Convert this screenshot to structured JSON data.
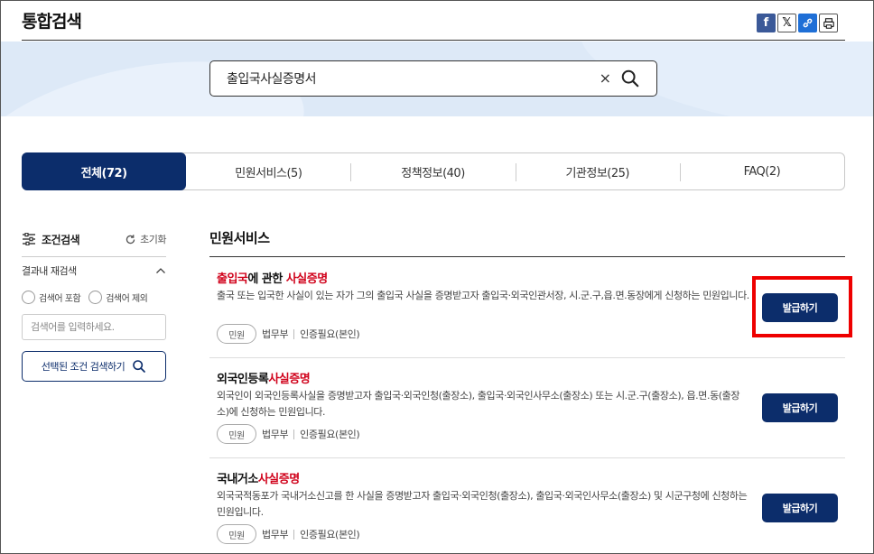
{
  "header": {
    "title": "통합검색",
    "share": [
      {
        "icon": "facebook-icon",
        "glyph": "f"
      },
      {
        "icon": "x-twitter-icon",
        "glyph": "𝕏"
      },
      {
        "icon": "link-icon",
        "glyph": "🔗"
      },
      {
        "icon": "print-icon",
        "glyph": ""
      }
    ]
  },
  "search": {
    "value": "출입국사실증명서",
    "clear_glyph": "×"
  },
  "tabs": [
    {
      "label": "전체(72)",
      "active": true
    },
    {
      "label": "민원서비스(5)",
      "active": false
    },
    {
      "label": "정책정보(40)",
      "active": false
    },
    {
      "label": "기관정보(25)",
      "active": false
    },
    {
      "label": "FAQ(2)",
      "active": false
    }
  ],
  "sidebar": {
    "title": "조건검색",
    "reset_label": "초기화",
    "refine_label": "결과내 재검색",
    "radio_include": "검색어 포함",
    "radio_exclude": "검색어 제외",
    "keyword_placeholder": "검색어를 입력하세요.",
    "search_button": "선택된 조건 검색하기"
  },
  "results": {
    "section_title": "민원서비스",
    "items": [
      {
        "title_pre": "출입국",
        "title_mid": "에 관한 ",
        "title_hl": "사실증명",
        "title_pre_red": true,
        "desc": "출국 또는 입국한 사실이 있는 자가 그의 출입국 사실을 증명받고자 출입국·외국인관서장, 시.군.구,읍.면.동장에게 신청하는 민원입니다.",
        "pill": "민원",
        "org": "법무부",
        "auth": "인증필요(본인)",
        "button": "발급하기"
      },
      {
        "title_pre": "외국인등록",
        "title_mid": "",
        "title_hl": "사실증명",
        "title_pre_red": false,
        "desc": "외국인이 외국인등록사실을 증명받고자 출입국·외국인청(출장소), 출입국·외국인사무소(출장소) 또는 시.군.구(출장소), 읍.면.동(출장소)에 신청하는 민원입니다.",
        "pill": "민원",
        "org": "법무부",
        "auth": "인증필요(본인)",
        "button": "발급하기"
      },
      {
        "title_pre": "국내거소",
        "title_mid": "",
        "title_hl": "사실증명",
        "title_pre_red": false,
        "desc": "외국국적동포가 국내거소신고를 한 사실을 증명받고자 출입국·외국인청(출장소), 출입국·외국인사무소(출장소) 및 시군구청에 신청하는 민원입니다.",
        "pill": "민원",
        "org": "법무부",
        "auth": "인증필요(본인)",
        "button": "발급하기"
      }
    ]
  },
  "colors": {
    "primary": "#0c2d6b",
    "highlight": "#d0021b",
    "annotation": "#e00000",
    "band": "#dde9f7"
  }
}
